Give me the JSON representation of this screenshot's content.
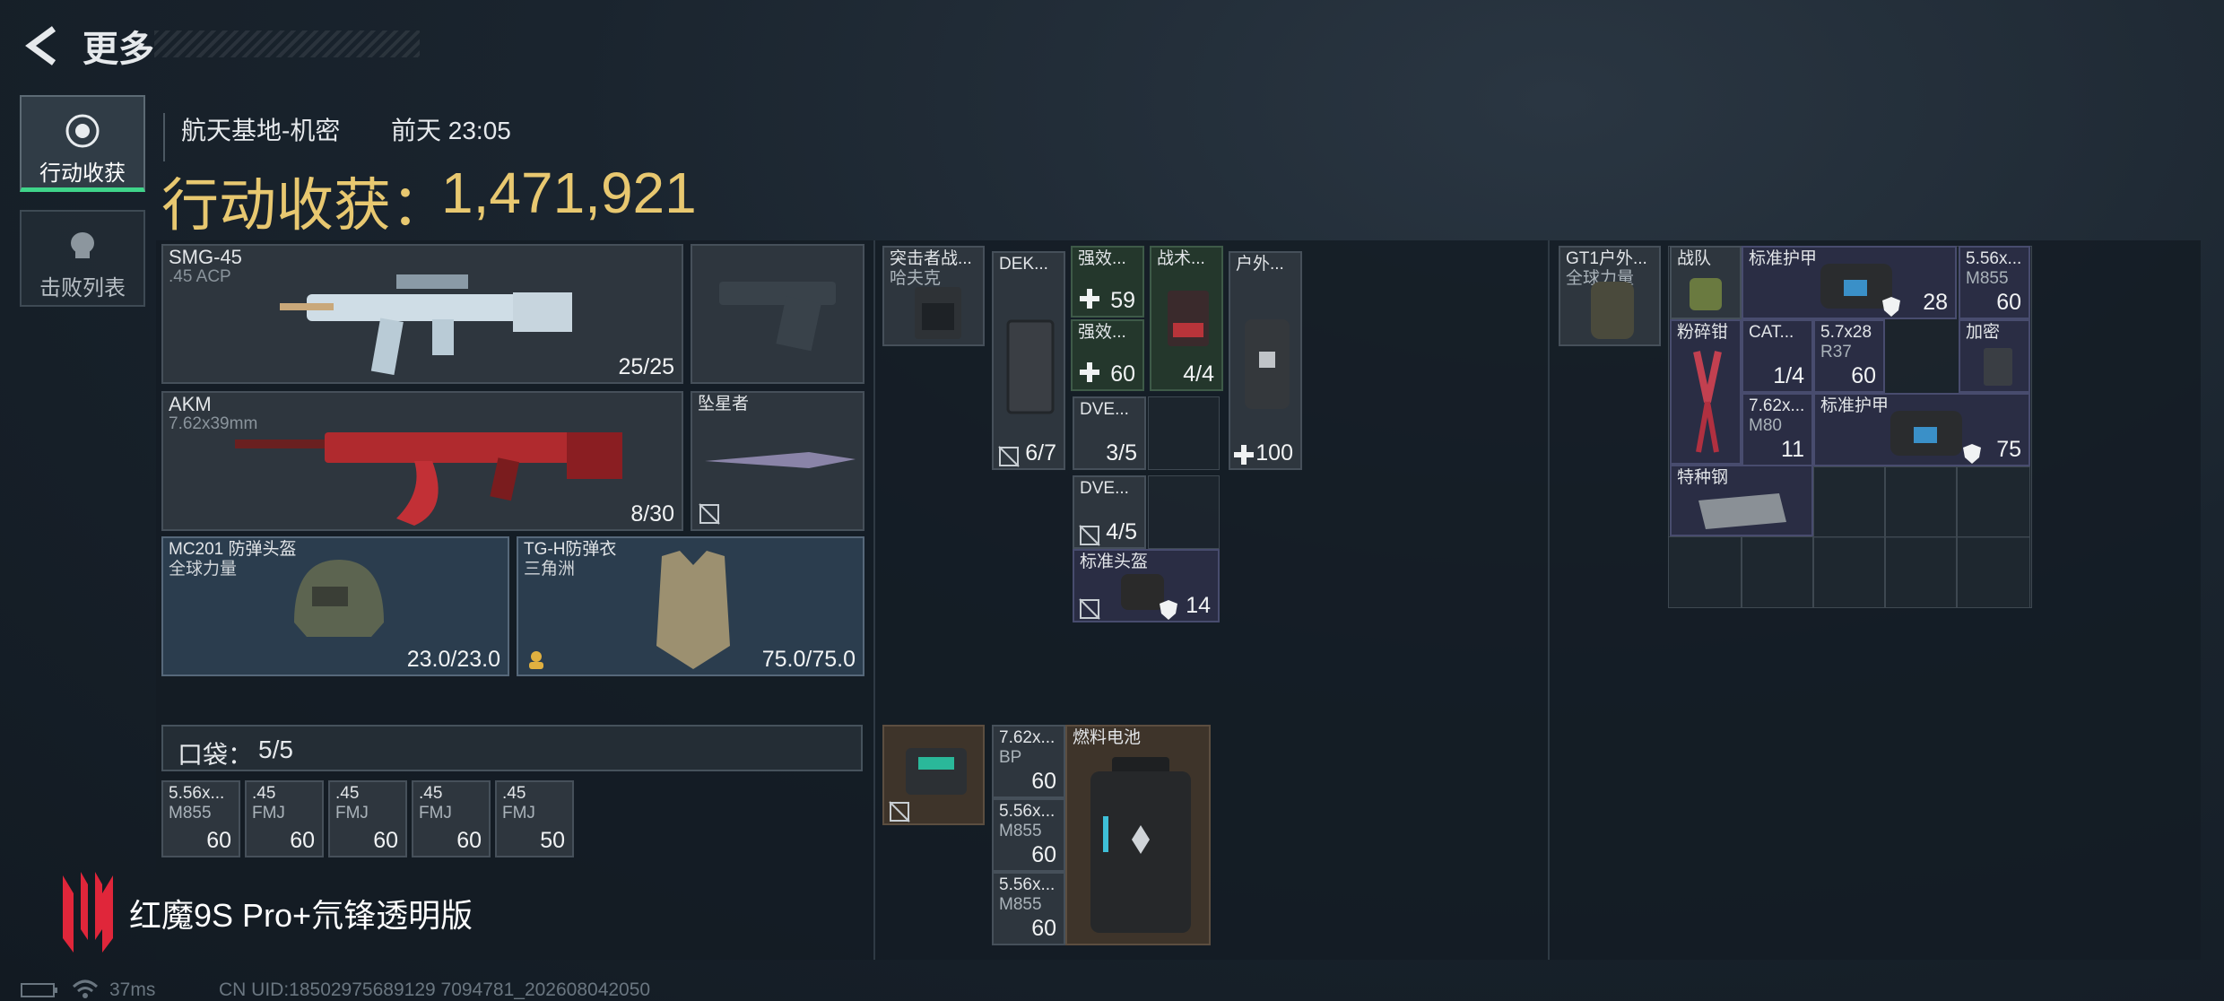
{
  "header": {
    "title": "更多"
  },
  "nav": [
    {
      "label": "行动收获",
      "active": true
    },
    {
      "label": "击败列表",
      "active": false
    }
  ],
  "info": {
    "location": "航天基地-机密",
    "time": "前天 23:05"
  },
  "summary": {
    "label": "行动收获：",
    "value": "1,471,921"
  },
  "weapons": [
    {
      "name": "SMG-45",
      "ammo": ".45 ACP",
      "count": "25/25"
    },
    {
      "name": "AKM",
      "ammo": "7.62x39mm",
      "count": "8/30"
    }
  ],
  "melee": {
    "name": "坠星者"
  },
  "helmet": {
    "name": "MC201 防弹头盔",
    "brand": "全球力量",
    "durability": "23.0/23.0"
  },
  "armor": {
    "name": "TG-H防弹衣",
    "brand": "三角洲",
    "durability": "75.0/75.0"
  },
  "pocket": {
    "label": "口袋：",
    "count": "5/5",
    "items": [
      {
        "name": "5.56x...",
        "sub": "M855",
        "qty": "60"
      },
      {
        "name": ".45",
        "sub": "FMJ",
        "qty": "60"
      },
      {
        "name": ".45",
        "sub": "FMJ",
        "qty": "60"
      },
      {
        "name": ".45",
        "sub": "FMJ",
        "qty": "60"
      },
      {
        "name": ".45",
        "sub": "FMJ",
        "qty": "50"
      }
    ]
  },
  "chest": {
    "rig": {
      "name": "突击者战...",
      "sub": "哈夫克"
    },
    "items": [
      {
        "name": "DEK...",
        "qty": "6/7"
      },
      {
        "name": "强效...",
        "qty": "59"
      },
      {
        "name": "强效...",
        "qty": "60"
      },
      {
        "name": "战术...",
        "qty": "4/4"
      },
      {
        "name": "户外...",
        "qty": "100"
      },
      {
        "name": "DVE...",
        "qty": "3/5"
      },
      {
        "name": "DVE...",
        "qty": "4/5"
      },
      {
        "name": "标准头盔",
        "qty": "14"
      }
    ]
  },
  "bag": {
    "items": [
      {
        "name": "7.62x...",
        "sub": "BP",
        "qty": "60"
      },
      {
        "name": "5.56x...",
        "sub": "M855",
        "qty": "60"
      },
      {
        "name": "5.56x...",
        "sub": "M855",
        "qty": "60"
      },
      {
        "name": "燃料电池",
        "qty": ""
      }
    ]
  },
  "backpack": {
    "bag": {
      "name": "GT1户外...",
      "sub": "全球力量"
    },
    "items": [
      {
        "name": "战队",
        "qty": ""
      },
      {
        "name": "标准护甲",
        "qty": "28"
      },
      {
        "name": "5.56x...",
        "sub": "M855",
        "qty": "60"
      },
      {
        "name": "粉碎钳",
        "qty": ""
      },
      {
        "name": "CAT...",
        "qty": "1/4"
      },
      {
        "name": "5.7x28",
        "sub": "R37",
        "qty": "60"
      },
      {
        "name": "加密",
        "qty": ""
      },
      {
        "name": "7.62x...",
        "sub": "M80",
        "qty": "11"
      },
      {
        "name": "标准护甲",
        "qty": "75"
      },
      {
        "name": "特种钢",
        "qty": ""
      }
    ]
  },
  "watermark": {
    "text": "红魔9S Pro+氘锋透明版"
  },
  "status": {
    "ping": "37ms",
    "uid": "CN UID:18502975689129 7094781_202608042050"
  },
  "colors": {
    "gold": "#e8c870",
    "accent": "#3fd48a"
  }
}
